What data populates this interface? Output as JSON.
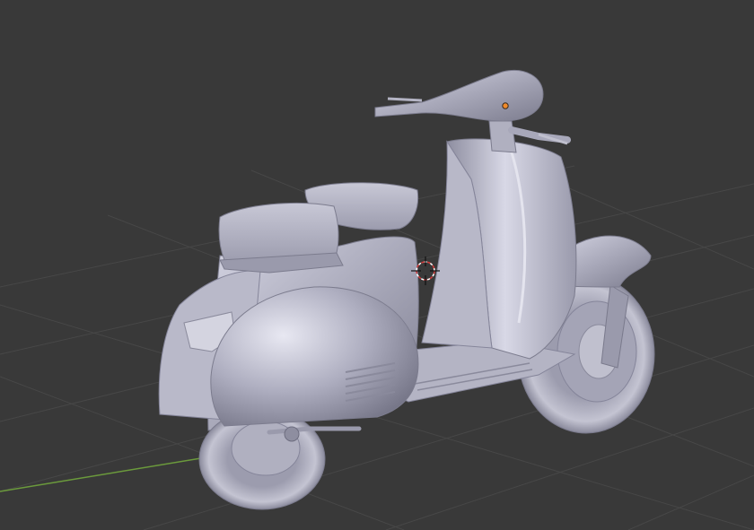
{
  "viewport": {
    "background": "#393939",
    "grid_color": "#474747",
    "x_axis_color": "#6b9a3c",
    "model_color": "#bcbccc",
    "object": "vespa-scooter-mesh",
    "cursor_icon": "3d-cursor-icon",
    "origin_icon": "object-origin-icon"
  }
}
